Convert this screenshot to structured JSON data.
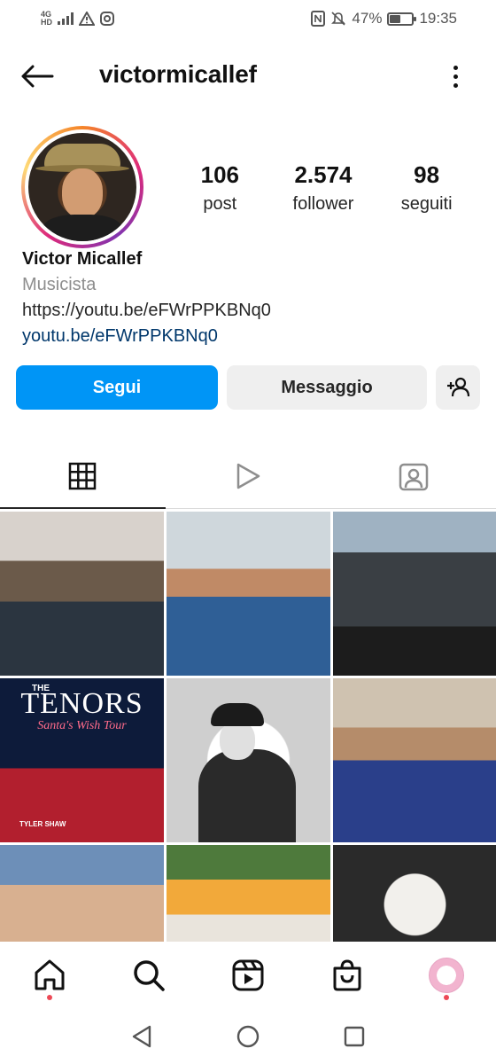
{
  "status_bar": {
    "network": "4G",
    "network_sub": "HD",
    "battery_percent": "47%",
    "battery_level": 0.47,
    "time": "19:35",
    "icons": [
      "signal-icon",
      "warning-icon",
      "instagram-icon",
      "nfc-icon",
      "mute-icon",
      "battery-icon"
    ]
  },
  "header": {
    "username": "victormicallef",
    "back_icon": "arrow-left-icon",
    "more_icon": "more-vertical-icon"
  },
  "profile": {
    "stats": [
      {
        "value": "106",
        "label": "post"
      },
      {
        "value": "2.574",
        "label": "follower"
      },
      {
        "value": "98",
        "label": "seguiti"
      }
    ],
    "name": "Victor Micallef",
    "category": "Musicista",
    "bio_text": "https://youtu.be/eFWrPPKBNq0",
    "website": "youtu.be/eFWrPPKBNq0"
  },
  "actions": {
    "follow_label": "Segui",
    "message_label": "Messaggio",
    "suggest_icon": "add-person-icon"
  },
  "tabs": [
    {
      "icon": "grid-icon",
      "active": true
    },
    {
      "icon": "reels-play-icon",
      "active": false
    },
    {
      "icon": "tagged-person-icon",
      "active": false
    }
  ],
  "grid_posts": {
    "tenors_the": "THE",
    "tenors_title": "TENORS",
    "tenors_subtitle": "Santa's Wish Tour",
    "tenors_credit": "TYLER SHAW"
  },
  "bottom_nav": [
    {
      "icon": "home-icon",
      "active": true
    },
    {
      "icon": "search-icon",
      "active": false
    },
    {
      "icon": "reels-icon",
      "active": false
    },
    {
      "icon": "shop-icon",
      "active": false
    },
    {
      "icon": "profile-avatar",
      "active": false
    }
  ],
  "system_nav": [
    "back-triangle-icon",
    "home-circle-icon",
    "recents-square-icon"
  ],
  "colors": {
    "follow_button": "#0095f6",
    "link": "#00376b",
    "secondary_button": "#efefef",
    "notification_dot": "#ed4956"
  }
}
